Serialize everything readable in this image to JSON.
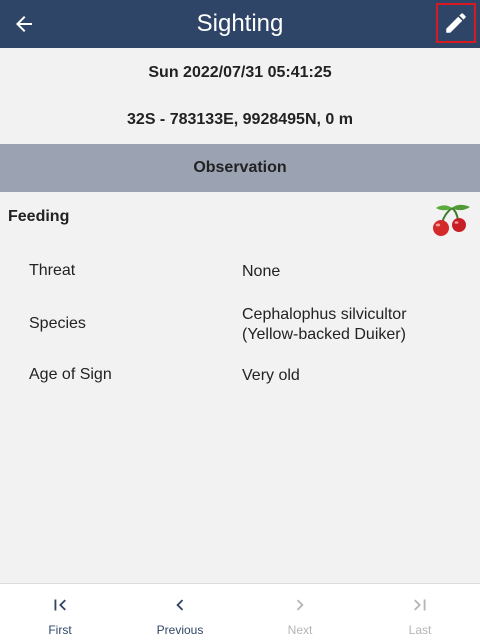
{
  "appbar": {
    "title": "Sighting",
    "back_icon": "arrow-left-icon",
    "edit_icon": "pencil-icon"
  },
  "header": {
    "datetime": "Sun 2022/07/31 05:41:25",
    "location": "32S - 783133E, 9928495N, 0 m"
  },
  "section": {
    "title": "Observation"
  },
  "observation": {
    "category": "Feeding",
    "category_icon": "cherries-icon",
    "fields": [
      {
        "label": "Threat",
        "value": "None"
      },
      {
        "label": "Species",
        "value": "Cephalophus silvicultor\n(Yellow-backed Duiker)"
      },
      {
        "label": "Age of Sign",
        "value": "Very old"
      }
    ]
  },
  "bottom_nav": {
    "first": {
      "label": "First",
      "icon": "first-page-icon",
      "enabled": true
    },
    "previous": {
      "label": "Previous",
      "icon": "chevron-left-icon",
      "enabled": true
    },
    "next": {
      "label": "Next",
      "icon": "chevron-right-icon",
      "enabled": false
    },
    "last": {
      "label": "Last",
      "icon": "last-page-icon",
      "enabled": false
    }
  },
  "colors": {
    "appbar": "#2f4567",
    "section": "#9ba3b3",
    "highlight": "#d8191f",
    "disabled": "#b5b5b5"
  }
}
